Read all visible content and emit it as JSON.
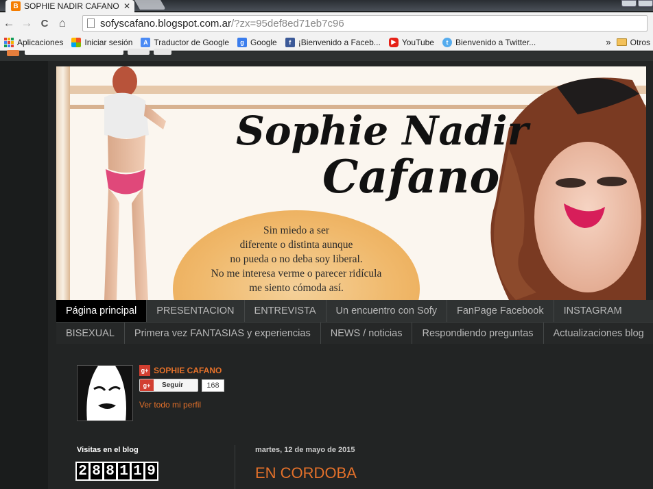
{
  "browser": {
    "tab_title": "SOPHIE NADIR CAFANO (",
    "tab_close": "✕",
    "url_host": "sofyscafano.blogspot.com.ar",
    "url_rest": "/?zx=95def8ed71eb7c96",
    "nav_back": "←",
    "nav_forward": "→",
    "nav_reload": "C",
    "nav_home": "⌂"
  },
  "bookmarks": {
    "items": [
      {
        "label": "Aplicaciones",
        "icon": "apps-icon"
      },
      {
        "label": "Iniciar sesión",
        "icon": "windows-icon"
      },
      {
        "label": "Traductor de Google",
        "icon": "translate-icon"
      },
      {
        "label": "Google",
        "icon": "google-icon"
      },
      {
        "label": "¡Bienvenido a Faceb...",
        "icon": "facebook-icon"
      },
      {
        "label": "YouTube",
        "icon": "youtube-icon"
      },
      {
        "label": "Bienvenido a Twitter...",
        "icon": "twitter-icon"
      }
    ],
    "overflow": "»",
    "other": "Otros"
  },
  "header": {
    "title_line1": "Sophie Nadir",
    "title_line2": "Cafano",
    "quote_lines": [
      "Sin miedo a ser",
      "diferente o distinta aunque",
      "no pueda o no deba soy liberal.",
      "No me interesa verme o parecer ridícula",
      "me siento cómoda así."
    ]
  },
  "nav": {
    "row1": [
      "Página principal",
      "PRESENTACION",
      "ENTREVISTA",
      "Un encuentro con Sofy",
      "FanPage Facebook",
      "INSTAGRAM"
    ],
    "row2": [
      "BISEXUAL",
      "Primera vez FANTASIAS y experiencias",
      "NEWS / noticias",
      "Respondiendo preguntas",
      "Actualizaciones blog"
    ],
    "active_index": 0
  },
  "profile": {
    "badge": "g+",
    "name": "SOPHIE CAFANO",
    "follow_label": "Seguir",
    "follow_count": "168",
    "profile_link": "Ver todo mi perfil"
  },
  "sidebar": {
    "visits_title": "Visitas en el blog",
    "counter_digits": [
      "2",
      "8",
      "8",
      "1",
      "1",
      "9"
    ]
  },
  "post": {
    "date": "martes, 12 de mayo de 2015",
    "title": "EN CORDOBA"
  },
  "colors": {
    "accent": "#e5712a",
    "nav_bg": "#2f3232",
    "page_bg": "#222424"
  }
}
